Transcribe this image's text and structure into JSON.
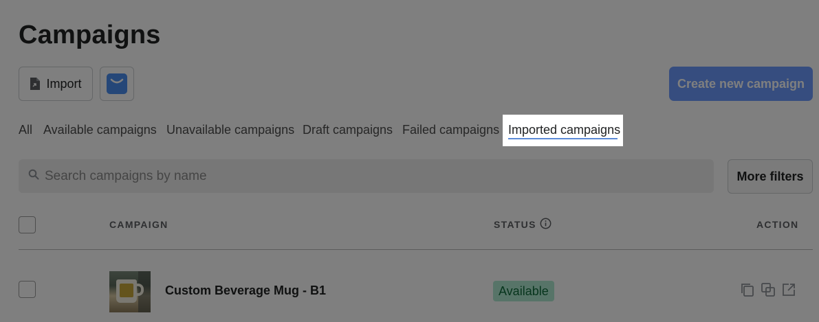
{
  "page": {
    "title": "Campaigns"
  },
  "toolbar": {
    "import_label": "Import",
    "create_label": "Create new campaign",
    "filters_label": "More filters",
    "accent_color": "#6d9bff"
  },
  "tabs": [
    {
      "label": "All"
    },
    {
      "label": "Available campaigns"
    },
    {
      "label": "Unavailable campaigns"
    },
    {
      "label": "Draft campaigns"
    },
    {
      "label": "Failed campaigns"
    },
    {
      "label": "Imported campaigns",
      "active": true
    }
  ],
  "search": {
    "placeholder": "Search campaigns by name",
    "value": ""
  },
  "table": {
    "columns": {
      "campaign": "CAMPAIGN",
      "status": "STATUS",
      "action": "ACTION"
    },
    "rows": [
      {
        "name": "Custom Beverage Mug - B1",
        "status": "Available",
        "status_color": "#aee9d1"
      }
    ]
  },
  "icons": {
    "import": "file-import-icon",
    "store": "store-logo-icon",
    "search": "search-icon",
    "info": "info-icon",
    "duplicate": "copy-icon",
    "clone": "layers-copy-icon",
    "open": "external-link-icon"
  }
}
